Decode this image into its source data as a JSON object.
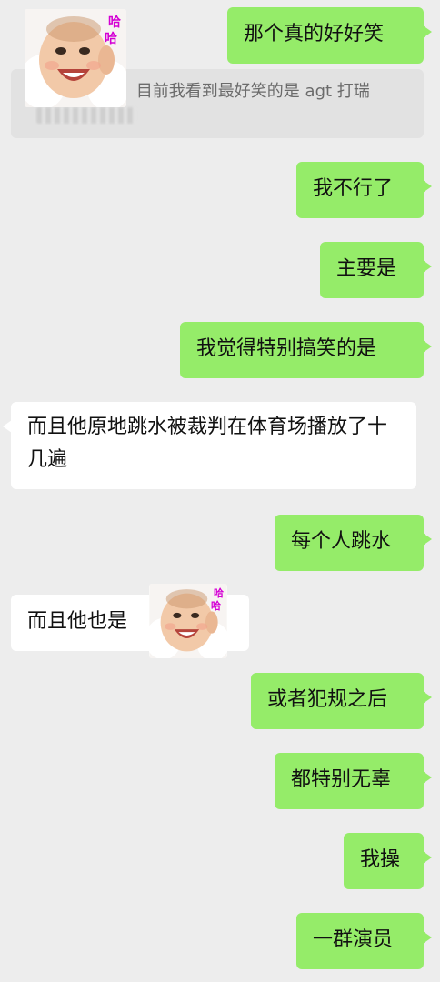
{
  "quote": {
    "prefix": ":",
    "text": "目前我看到最好笑的是 agt 打瑞"
  },
  "sticker": {
    "label_top": "哈",
    "label_bottom": "哈",
    "label_color": "#d400d4"
  },
  "messages": [
    {
      "side": "sent",
      "text": "那个真的好好笑"
    },
    {
      "side": "sent",
      "text": "我不行了"
    },
    {
      "side": "sent",
      "text": "主要是"
    },
    {
      "side": "sent",
      "text": "我觉得特别搞笑的是"
    },
    {
      "side": "received",
      "text": "而且他原地跳水被裁判在体育场播放了十几遍"
    },
    {
      "side": "sent",
      "text": "每个人跳水"
    },
    {
      "side": "received",
      "text": "而且他也是"
    },
    {
      "side": "sent",
      "text": "或者犯规之后"
    },
    {
      "side": "sent",
      "text": "都特别无辜"
    },
    {
      "side": "sent",
      "text": "我操"
    },
    {
      "side": "sent",
      "text": "一群演员"
    }
  ],
  "colors": {
    "background": "#ededed",
    "sent_bubble": "#95ec69",
    "received_bubble": "#ffffff"
  }
}
